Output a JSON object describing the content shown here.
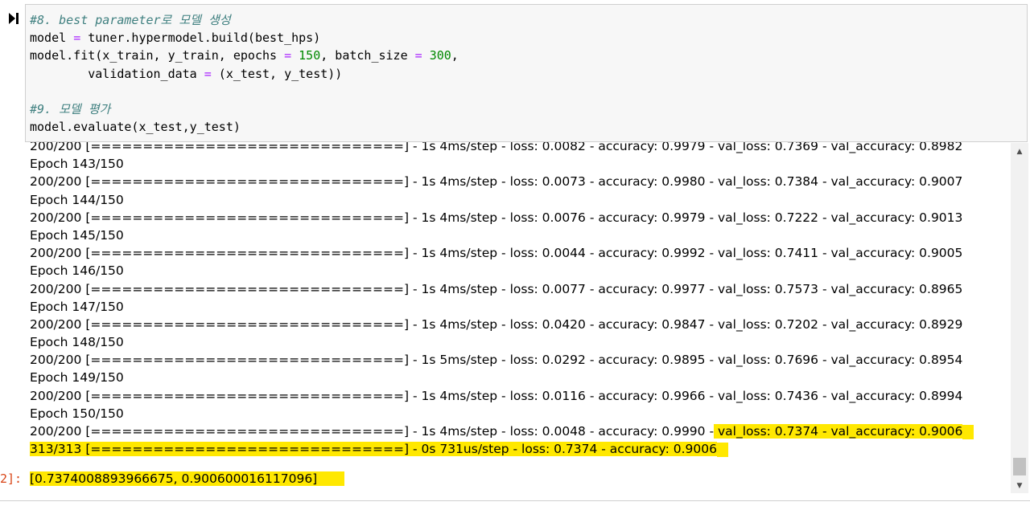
{
  "cell": {
    "run_icon": "run-step-icon",
    "code": [
      [
        {
          "t": "#8. best parameter로 모델 생성",
          "c": "comment"
        }
      ],
      [
        {
          "t": "model "
        },
        {
          "t": "=",
          "c": "op"
        },
        {
          "t": " tuner.hypermodel.build(best_hps)"
        }
      ],
      [
        {
          "t": "model.fit(x_train, y_train, epochs "
        },
        {
          "t": "=",
          "c": "op"
        },
        {
          "t": " "
        },
        {
          "t": "150",
          "c": "num"
        },
        {
          "t": ", batch_size "
        },
        {
          "t": "=",
          "c": "op"
        },
        {
          "t": " "
        },
        {
          "t": "300",
          "c": "num"
        },
        {
          "t": ","
        }
      ],
      [
        {
          "t": "        validation_data "
        },
        {
          "t": "=",
          "c": "op"
        },
        {
          "t": " (x_test, y_test))"
        }
      ],
      [
        {
          "t": ""
        }
      ],
      [
        {
          "t": "#9. 모델 평가",
          "c": "comment"
        }
      ],
      [
        {
          "t": "model.evaluate(x_test,y_test)"
        }
      ]
    ]
  },
  "output": {
    "lines": [
      {
        "text": "200/200 [==============================] - 1s 4ms/step - loss: 0.0082 - accuracy: 0.9979 - val_loss: 0.7369 - val_accuracy: 0.8982"
      },
      {
        "text": "Epoch 143/150"
      },
      {
        "text": "200/200 [==============================] - 1s 4ms/step - loss: 0.0073 - accuracy: 0.9980 - val_loss: 0.7384 - val_accuracy: 0.9007"
      },
      {
        "text": "Epoch 144/150"
      },
      {
        "text": "200/200 [==============================] - 1s 4ms/step - loss: 0.0076 - accuracy: 0.9979 - val_loss: 0.7222 - val_accuracy: 0.9013"
      },
      {
        "text": "Epoch 145/150"
      },
      {
        "text": "200/200 [==============================] - 1s 4ms/step - loss: 0.0044 - accuracy: 0.9992 - val_loss: 0.7411 - val_accuracy: 0.9005"
      },
      {
        "text": "Epoch 146/150"
      },
      {
        "text": "200/200 [==============================] - 1s 4ms/step - loss: 0.0077 - accuracy: 0.9977 - val_loss: 0.7573 - val_accuracy: 0.8965"
      },
      {
        "text": "Epoch 147/150"
      },
      {
        "text": "200/200 [==============================] - 1s 4ms/step - loss: 0.0420 - accuracy: 0.9847 - val_loss: 0.7202 - val_accuracy: 0.8929"
      },
      {
        "text": "Epoch 148/150"
      },
      {
        "text": "200/200 [==============================] - 1s 5ms/step - loss: 0.0292 - accuracy: 0.9895 - val_loss: 0.7696 - val_accuracy: 0.8954"
      },
      {
        "text": "Epoch 149/150"
      },
      {
        "text": "200/200 [==============================] - 1s 4ms/step - loss: 0.0116 - accuracy: 0.9966 - val_loss: 0.7436 - val_accuracy: 0.8994"
      },
      {
        "text": "Epoch 150/150"
      },
      {
        "text": "200/200 [==============================] - 1s 4ms/step - loss: 0.0048 - accuracy: 0.9990 -",
        "highlight": " val_loss: 0.7374 - val_accuracy: 0.9006"
      },
      {
        "highlight": "313/313 [==============================] - 0s 731us/step - loss: 0.7374 - accuracy: 0.9006"
      }
    ],
    "result_prompt": "2]:",
    "result_value": "[0.7374008893966675, 0.900600016117096]"
  },
  "colors": {
    "highlight": "#ffe800",
    "comment": "#408080",
    "operator": "#aa22ff",
    "number": "#008800",
    "prompt": "#d84315"
  }
}
